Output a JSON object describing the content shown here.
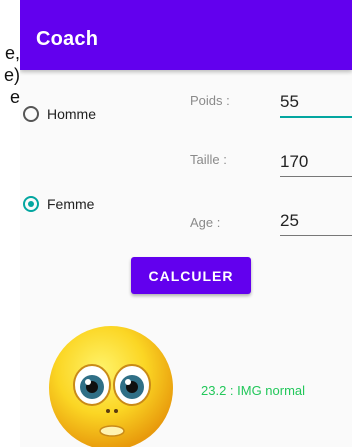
{
  "background_text": [
    "e,",
    "e)",
    "e"
  ],
  "app": {
    "title": "Coach",
    "accent": "#6200ee",
    "teal": "#03a6a0"
  },
  "gender": {
    "options": [
      {
        "label": "Homme",
        "checked": false
      },
      {
        "label": "Femme",
        "checked": true
      }
    ]
  },
  "fields": {
    "poids": {
      "label": "Poids :",
      "value": "55"
    },
    "taille": {
      "label": "Taille :",
      "value": "170"
    },
    "age": {
      "label": "Age :",
      "value": "25"
    }
  },
  "button": {
    "label": "CALCULER"
  },
  "result": {
    "text": "23.2 : IMG normal",
    "color": "#22c75a"
  },
  "image": {
    "icon": "smiley-face-icon"
  }
}
